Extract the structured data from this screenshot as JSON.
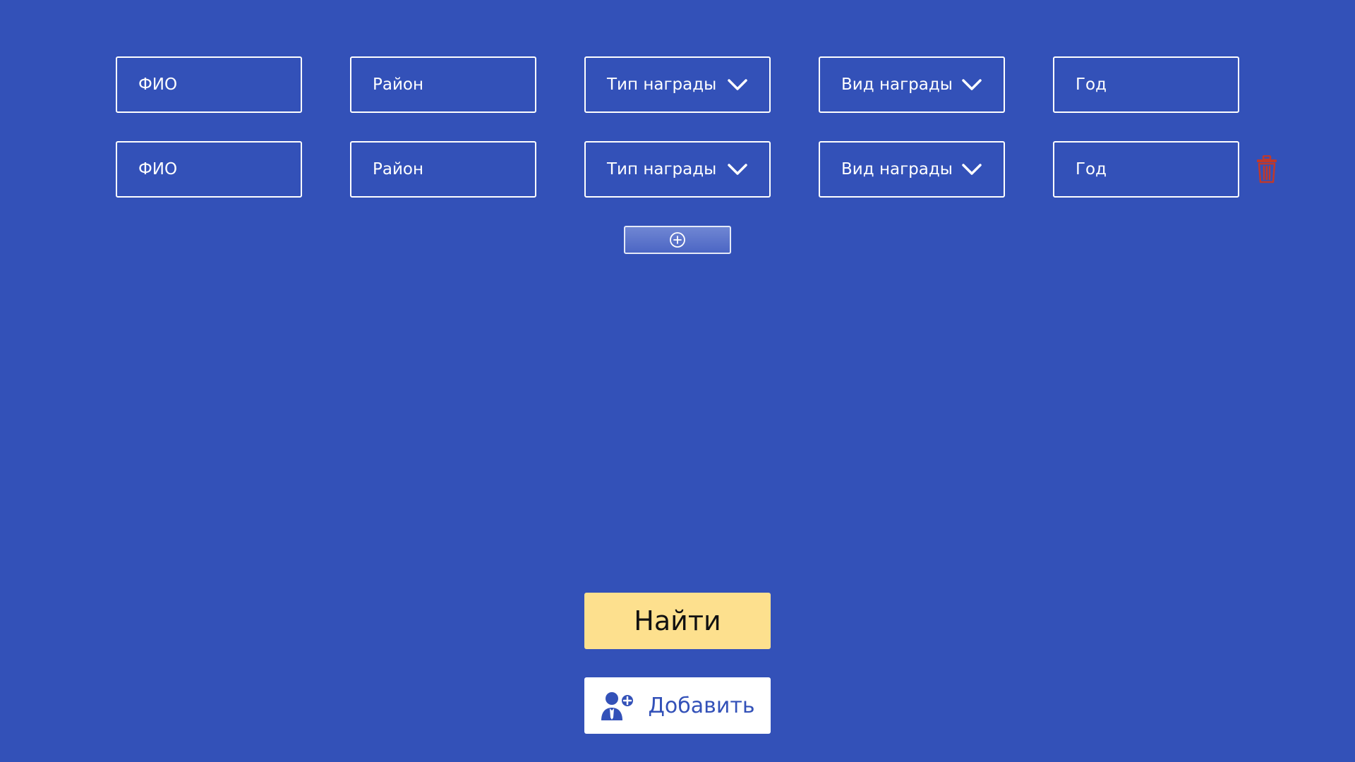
{
  "colors": {
    "background": "#3351b8",
    "field_border": "#ffffff",
    "find_button": "#fde08e",
    "delete_icon": "#c0392b",
    "add_button_text": "#3351b8"
  },
  "rows": [
    {
      "fio_placeholder": "ФИО",
      "district_placeholder": "Район",
      "award_type_label": "Тип награды",
      "award_kind_label": "Вид награды",
      "year_placeholder": "Год"
    },
    {
      "fio_placeholder": "ФИО",
      "district_placeholder": "Район",
      "award_type_label": "Тип награды",
      "award_kind_label": "Вид награды",
      "year_placeholder": "Год",
      "delete_icon": "trash-icon"
    }
  ],
  "add_row_icon": "plus-circle-icon",
  "buttons": {
    "find_label": "Найти",
    "add_label": "Добавить",
    "add_icon": "add-person-icon"
  }
}
